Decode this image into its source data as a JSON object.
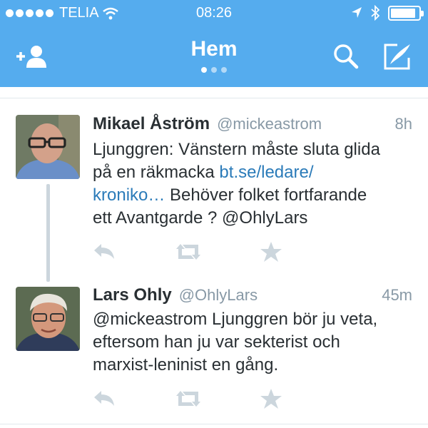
{
  "status_bar": {
    "carrier": "TELIA",
    "time": "08:26",
    "battery_level": 0.9
  },
  "nav": {
    "title": "Hem",
    "pager": {
      "count": 3,
      "active": 0
    },
    "icons": {
      "left": "add-user-icon",
      "search": "search-icon",
      "compose": "compose-icon"
    }
  },
  "colors": {
    "header_bg": "#55acee",
    "link": "#2b7bb9",
    "name": "#292f33",
    "meta": "#8899a6",
    "action": "#ccd6dd"
  },
  "tweets": [
    {
      "name": "Mikael Åström",
      "handle": "@mickeastrom",
      "time": "8h",
      "text_line1": "Ljunggren: Vänstern måste sluta glida",
      "text_line2_plain": "på en räkmacka ",
      "text_line2_link": "bt.se/ledare/",
      "text_line3_link": "kroniko…",
      "text_line3_plain": " Behöver folket fortfarande",
      "text_line4": "ett Avantgarde ? @OhlyLars",
      "actions": [
        "reply-icon",
        "retweet-icon",
        "favorite-icon"
      ]
    },
    {
      "name": "Lars Ohly",
      "handle": "@OhlyLars",
      "time": "45m",
      "text_line1": "@mickeastrom Ljunggren bör ju veta,",
      "text_line2": "eftersom han ju var sekterist och",
      "text_line3": "marxist-leninist en gång.",
      "actions": [
        "reply-icon",
        "retweet-icon",
        "favorite-icon"
      ]
    }
  ]
}
